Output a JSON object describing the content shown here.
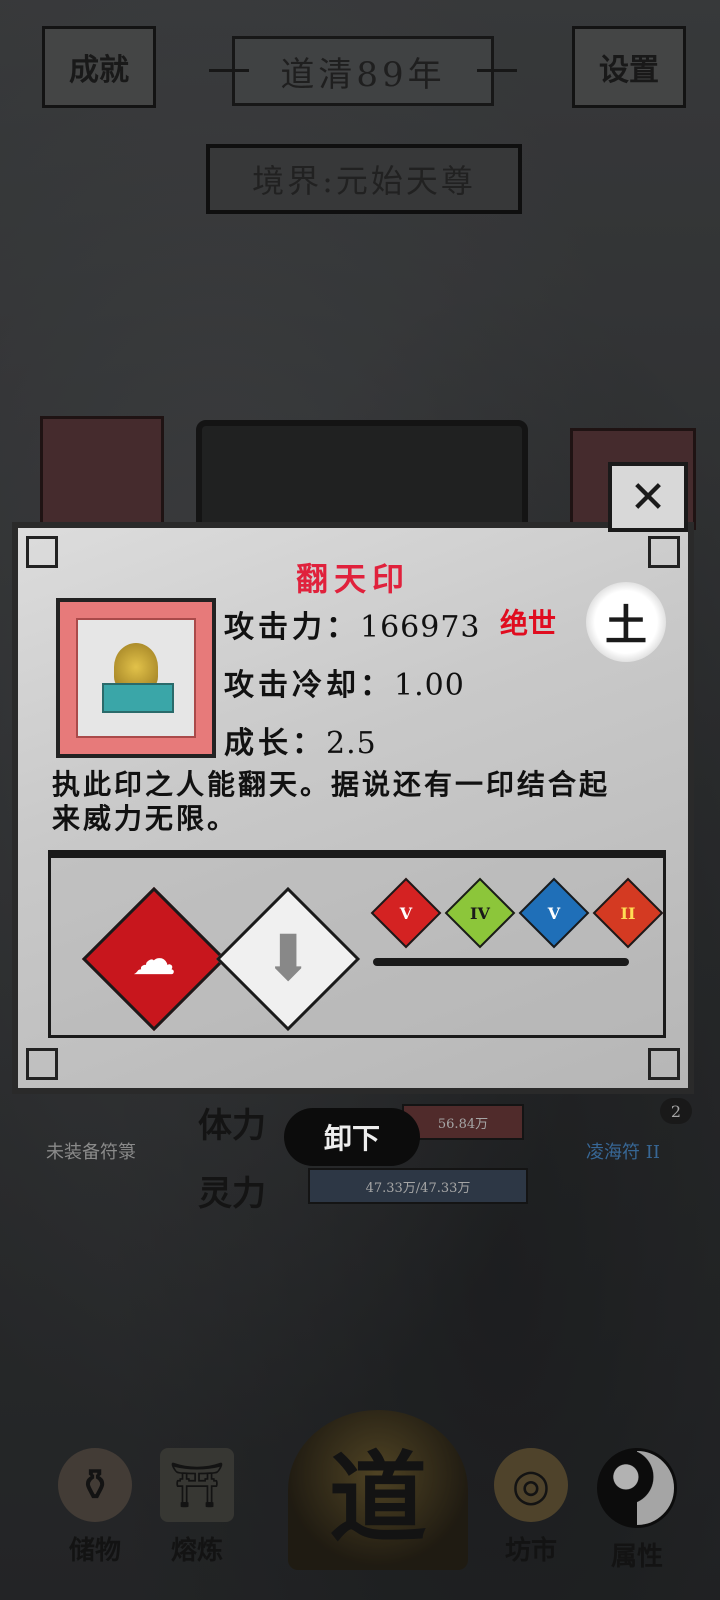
{
  "header": {
    "achievements_label": "成就",
    "year_label": "道清89年",
    "settings_label": "设置",
    "realm_label": "境界:元始天尊"
  },
  "background": {
    "unequipped_label": "未装备符箓",
    "right_label": "凌海符 II",
    "badge_count": "2",
    "hp_label": "体力",
    "hp_value": "56.84万",
    "mp_label": "灵力",
    "mp_value": "47.33万/47.33万"
  },
  "modal": {
    "item_name": "翻天印",
    "attack_label": "攻击力：",
    "attack_value": "166973",
    "cooldown_label": "攻击冷却：",
    "cooldown_value": "1.00",
    "growth_label": "成长：",
    "growth_value": "2.5",
    "rarity": "绝世",
    "element": "土",
    "description": "执此印之人能翻天。据说还有一印结合起来威力无限。",
    "close_icon": "close-icon",
    "gems": [
      "V",
      "IV",
      "V",
      "II"
    ],
    "colors": {
      "rarity": "#e00c1f",
      "name": "#e0213c",
      "skill_diamond": "#c8161d"
    }
  },
  "unequip_button": "卸下",
  "nav": {
    "items": [
      {
        "label": "储物",
        "icon": "pouch-icon"
      },
      {
        "label": "熔炼",
        "icon": "furnace-icon"
      },
      {
        "label": "道",
        "icon": "dao-icon"
      },
      {
        "label": "坊市",
        "icon": "coins-icon"
      },
      {
        "label": "属性",
        "icon": "yin-yang-icon"
      }
    ]
  }
}
